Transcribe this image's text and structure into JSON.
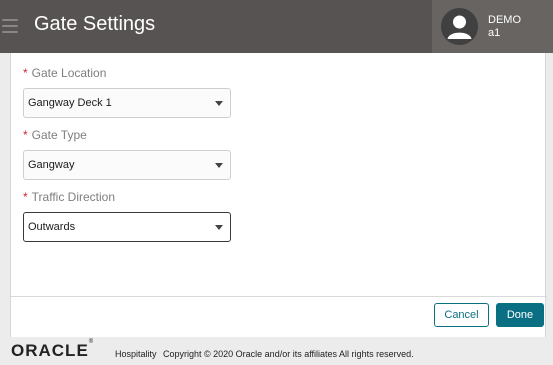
{
  "header": {
    "title": "Gate Settings",
    "menu_icon": "hamburger-menu-icon",
    "user": {
      "line1": "DEMO",
      "line2": "a1",
      "avatar_icon": "user-avatar-icon"
    }
  },
  "form": {
    "fields": [
      {
        "required_mark": "*",
        "label": "Gate Location",
        "value": "Gangway Deck 1"
      },
      {
        "required_mark": "*",
        "label": "Gate Type",
        "value": "Gangway"
      },
      {
        "required_mark": "*",
        "label": "Traffic Direction",
        "value": "Outwards"
      }
    ]
  },
  "actions": {
    "cancel_label": "Cancel",
    "done_label": "Done"
  },
  "footer": {
    "logo_text": "ORACLE",
    "logo_mark": "®",
    "product": "Hospitality",
    "copyright": "Copyright © 2020 Oracle and/or its affiliates All rights reserved."
  },
  "colors": {
    "header_bg": "#575352",
    "user_box_bg": "#686462",
    "required": "#d1262b",
    "primary": "#0b6f84"
  }
}
